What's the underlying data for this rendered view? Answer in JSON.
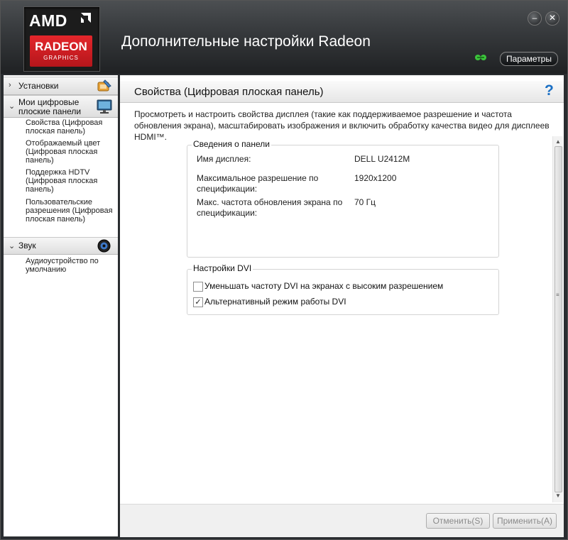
{
  "logo": {
    "amd": "AMD",
    "radeon": "RADEON",
    "graphics": "GRAPHICS"
  },
  "window": {
    "title": "Дополнительные настройки Radeon",
    "minimize_label": "–",
    "close_label": "✕",
    "params_label": "Параметры"
  },
  "sidebar": {
    "sections": [
      {
        "label": "Установки",
        "chevron": "›",
        "icon": "install-icon",
        "items": []
      },
      {
        "label": "Мои цифровые плоские панели",
        "chevron": "⌄",
        "icon": "monitor-icon",
        "items": [
          "Свойства (Цифровая плоская панель)",
          "Отображаемый цвет (Цифровая плоская панель)",
          "Поддержка HDTV (Цифровая плоская панель)",
          "Пользовательские разрешения (Цифровая плоская панель)"
        ]
      },
      {
        "label": "Звук",
        "chevron": "⌄",
        "icon": "speaker-icon",
        "items": [
          "Аудиоустройство по умолчанию"
        ]
      }
    ]
  },
  "main": {
    "title": "Свойства (Цифровая плоская панель)",
    "help": "?",
    "description": "Просмотреть и настроить свойства дисплея (такие как поддерживаемое разрешение и частота обновления экрана), масштабировать изображения и включить обработку качества видео для дисплеев HDMI™.",
    "panel_info": {
      "legend": "Сведения о панели",
      "rows": [
        {
          "label": "Имя дисплея:",
          "value": "DELL U2412M"
        },
        {
          "label": "Максимальное разрешение по спецификации:",
          "value": "1920x1200"
        },
        {
          "label": "Макс. частота обновления экрана по спецификации:",
          "value": "70 Гц"
        }
      ]
    },
    "dvi": {
      "legend": "Настройки DVI",
      "options": [
        {
          "label": "Уменьшать частоту DVI на экранах с высоким разрешением",
          "checked": false
        },
        {
          "label": "Альтернативный режим работы DVI",
          "checked": true
        }
      ]
    }
  },
  "footer": {
    "cancel_label": "Отменить(S)",
    "apply_label": "Применить(A)"
  },
  "colors": {
    "header_bg": "#2a2d30",
    "amd_red": "#d8161b",
    "help_blue": "#1a6fc4",
    "conn_green": "#3cc43c"
  }
}
